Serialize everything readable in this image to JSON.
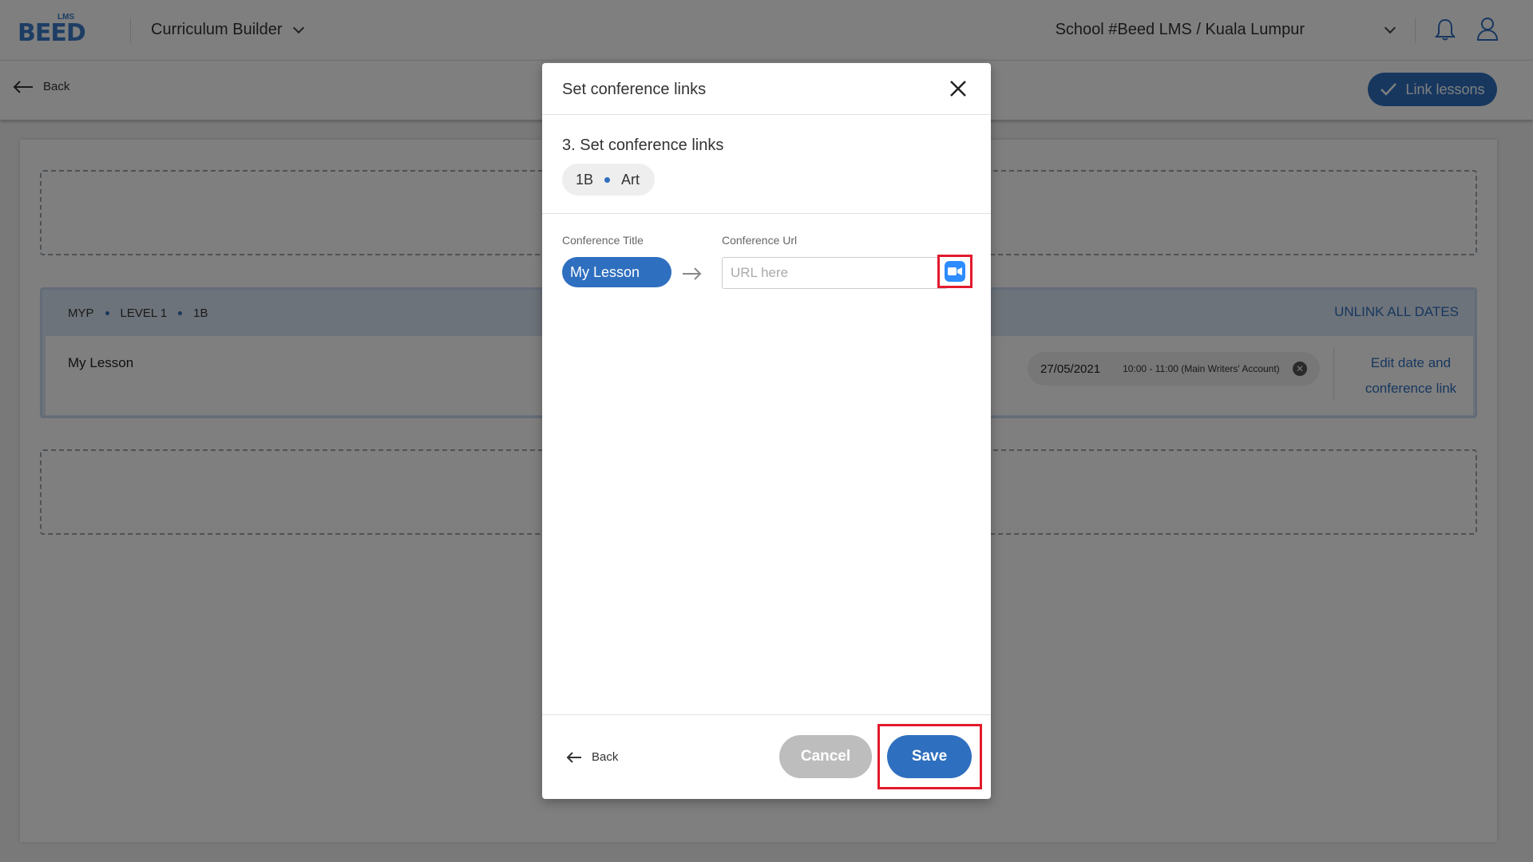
{
  "app": {
    "logo_text": "BEED",
    "logo_sup": "LMS",
    "nav_title": "Curriculum Builder",
    "school": "School #Beed LMS / Kuala Lumpur"
  },
  "subbar": {
    "back_label": "Back",
    "link_lessons_label": "Link lessons"
  },
  "group": {
    "crumbs": [
      "MYP",
      "LEVEL 1",
      "1B"
    ],
    "unlink_label": "UNLINK ALL DATES",
    "row": {
      "title": "My Lesson",
      "date": "27/05/2021",
      "time": "10:00 - 11:00 (Main Writers' Account)",
      "edit_link": "Edit date and conference link"
    }
  },
  "modal": {
    "title": "Set conference links",
    "step_title": "3. Set conference links",
    "chip": {
      "class": "1B",
      "subject": "Art"
    },
    "conference_title_label": "Conference Title",
    "conference_url_label": "Conference Url",
    "conference_title_value": "My Lesson",
    "url_placeholder": "URL here",
    "back_label": "Back",
    "cancel_label": "Cancel",
    "save_label": "Save"
  },
  "colors": {
    "accent": "#2f6fbf",
    "highlight": "#e21a2c",
    "zoom": "#2d8cff"
  },
  "icons": [
    "bell-icon",
    "user-icon",
    "chevron-down-icon",
    "check-icon",
    "arrow-left-icon",
    "close-icon",
    "arrow-right-icon",
    "video-camera-icon",
    "x-circle-icon"
  ]
}
